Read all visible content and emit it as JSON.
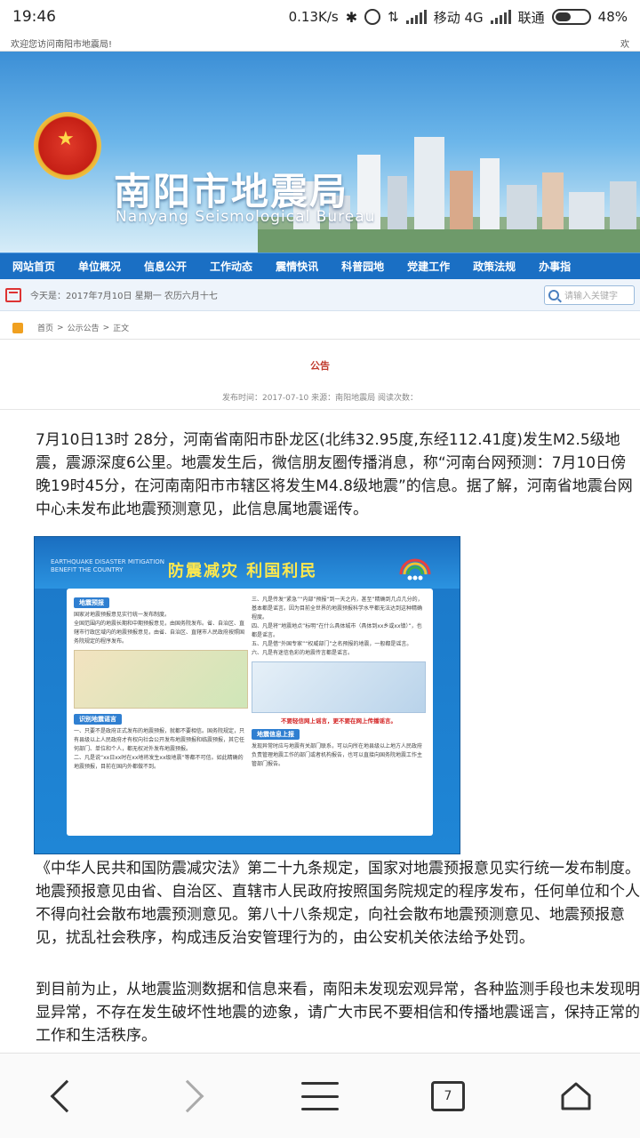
{
  "status_bar": {
    "time": "19:46",
    "speed": "0.13K/s",
    "carrier1": "移动 4G",
    "carrier2": "联通",
    "battery": "48%",
    "battery_level": 0.48
  },
  "welcome": {
    "left": "欢迎您访问南阳市地震局!",
    "right": "欢"
  },
  "banner": {
    "title": "南阳市地震局",
    "subtitle": "Nanyang Seismological Bureau"
  },
  "nav": {
    "items": [
      "网站首页",
      "单位概况",
      "信息公开",
      "工作动态",
      "震情快讯",
      "科普园地",
      "党建工作",
      "政策法规",
      "办事指"
    ]
  },
  "date_row": {
    "date": "今天是：2017年7月10日 星期一 农历六月十七",
    "search_placeholder": "请输入关键字"
  },
  "breadcrumb": {
    "home": "首页",
    "section": "公示公告",
    "current": "正文",
    "sep": ">"
  },
  "article": {
    "title": "公告",
    "meta": "发布时间：2017-07-10 来源：南阳地震局 阅读次数：",
    "p1": "7月10日13时 28分，河南省南阳市卧龙区(北纬32.95度,东经112.41度)发生M2.5级地震，震源深度6公里。地震发生后，微信朋友圈传播消息，称“河南台网预测：7月10日傍晚19时45分，在河南南阳市市辖区将发生M4.8级地震”的信息。据了解，河南省地震台网中心未发布此地震预测意见，此信息属地震谣传。",
    "p2": "《中华人民共和国防震减灾法》第二十九条规定，国家对地震预报意见实行统一发布制度。地震预报意见由省、自治区、直辖市人民政府按照国务院规定的程序发布，任何单位和个人不得向社会散布地震预测意见。第八十八条规定，向社会散布地震预测意见、地震预报意见，扰乱社会秩序，构成违反治安管理行为的，由公安机关依法给予处罚。",
    "p3": "到目前为止，从地震监测数据和信息来看，南阳未发现宏观异常，各种监测手段也未发现明显异常，不存在发生破坏性地震的迹象，请广大市民不要相信和传播地震谣言，保持正常的工作和生活秩序。"
  },
  "poster": {
    "en_line1": "EARTHQUAKE DISASTER MITIGATION",
    "en_line2": "BENEFIT THE COUNTRY",
    "slogan": "防震减灾 利国利民",
    "tag1": "地震预报",
    "left_text1": "国家对地震预报意见实行统一发布制度。",
    "left_text2": "全国范围内的地震长期和中期预报意见，由国务院发布。省、自治区、直辖市行政区域内的地震预报意见，由省、自治区、直辖市人民政府按照国务院规定的程序发布。",
    "tag2": "识别地震谣言",
    "left_text3": "一、只要不是政府正式发布的地震预报，就都不要相信。国务院规定，只有县级以上人民政府才有权向社会公开发布地震预报和临震预报，其它任何部门、单位和个人，都无权对外发布地震预报。",
    "left_text4": "二、凡是说“xx日xx时在xx地将发生xx级地震”等都不可信。如此精确的地震预报，目前在国内外都做不到。",
    "right_text1": "三、凡是传发“紧急”“内部”预报“到一天之内，甚至”精确到几点几分的，基本都是谣言。因为目前全世界的地震预报科学水平都无法达到这种精确程度。",
    "right_text2": "四、凡是将“地震地点”标明“在什么具体城市（具体到xx乡或xx镇）”，也都是谣言。",
    "right_text3": "五、凡是借“外国专家”“权威部门”之名预报的地震，一般都是谣言。",
    "right_text4": "六、凡是有迷信色彩的地震传言都是谣言。",
    "warn": "不要轻信网上谣言，更不要在网上传播谣言。",
    "tag3": "地震信息上报",
    "right_text5": "发现异常时应与地震有关部门联系，可以向所在地县级以上地方人民政府负责管理地震工作的部门或者机构报告，也可以直接向国务院地震工作主管部门报告。"
  },
  "bottom_nav": {
    "tab_count": "7"
  }
}
